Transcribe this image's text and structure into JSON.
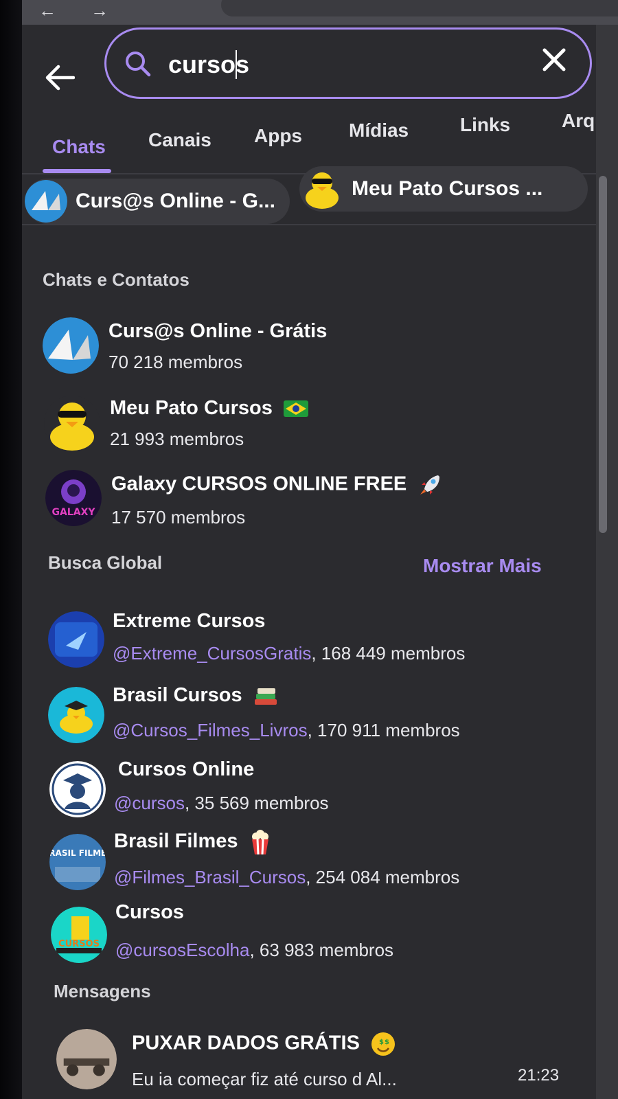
{
  "search": {
    "query": "cursos"
  },
  "tabs": [
    {
      "label": "Chats"
    },
    {
      "label": "Canais"
    },
    {
      "label": "Apps"
    },
    {
      "label": "Mídias"
    },
    {
      "label": "Links"
    },
    {
      "label": "Arqu"
    }
  ],
  "chips": [
    {
      "label": "Curs@s Online - G..."
    },
    {
      "label": "Meu Pato Cursos ..."
    }
  ],
  "sections": {
    "chats_contacts": "Chats e Contatos",
    "global_search": "Busca Global",
    "show_more": "Mostrar Mais",
    "messages": "Mensagens"
  },
  "chats": [
    {
      "title": "Curs@s Online - Grátis",
      "members": "70 218 membros"
    },
    {
      "title": "Meu Pato Cursos",
      "members": "21 993 membros"
    },
    {
      "title": "Galaxy CURSOS ONLINE FREE",
      "members": "17 570 membros"
    }
  ],
  "global": [
    {
      "title": "Extreme Cursos",
      "username": "@Extreme_CursosGratis",
      "members": ", 168 449 membros"
    },
    {
      "title": "Brasil Cursos",
      "username": "@Cursos_Filmes_Livros",
      "members": ", 170 911 membros"
    },
    {
      "title": "Cursos Online",
      "username": "@cursos",
      "members": ", 35 569 membros"
    },
    {
      "title": "Brasil Filmes",
      "username": "@Filmes_Brasil_Cursos",
      "members": ", 254 084 membros"
    },
    {
      "title": "Cursos",
      "username": "@cursosEscolha",
      "members": ", 63 983 membros"
    }
  ],
  "messages": [
    {
      "title": "PUXAR DADOS GRÁTIS",
      "preview": "Eu ia começar fiz até curso d Al...",
      "time": "21:23"
    }
  ],
  "avatar_texts": {
    "galaxy": "GALAXY",
    "brasil_filmes": "BRASIL FILMES",
    "cursos": "CURSOS"
  },
  "colors": {
    "accent": "#a88bf0",
    "background": "#2b2b2f",
    "chip": "#3a3a3f"
  },
  "icons": [
    "back-arrow-icon",
    "search-icon",
    "close-icon",
    "brazil-flag-icon",
    "rocket-icon",
    "books-icon",
    "popcorn-icon",
    "money-face-icon"
  ]
}
